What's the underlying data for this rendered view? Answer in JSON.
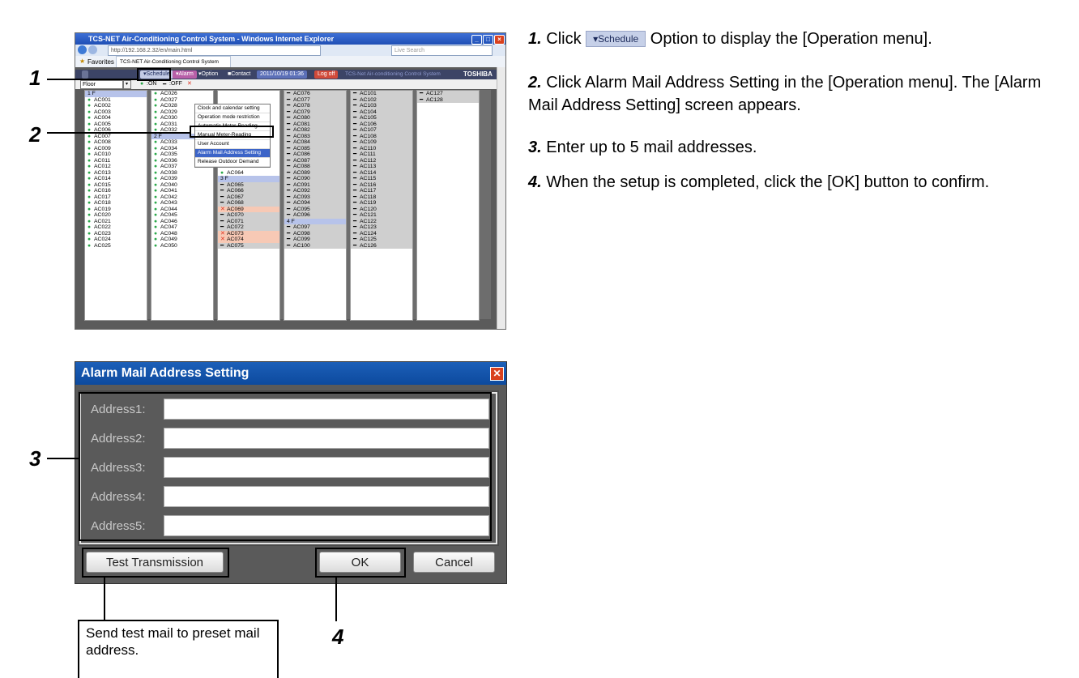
{
  "browser": {
    "title": "TCS-NET Air-Conditioning Control System - Windows Internet Explorer",
    "url": "http://192.168.2.32/en/main.html",
    "search_placeholder": "Live Search",
    "favorites_label": "Favorites",
    "tab_label": "TCS-NET Air-Conditioning Control System"
  },
  "app_nav": {
    "schedule": "▾Schedule",
    "alarm": "▾Alarm",
    "option": "▾Option",
    "contact": "■Contact",
    "datetime": "2011/10/19 01:36",
    "logoff": "Log off",
    "system_name": "TCS-Net Air-conditioning Control System",
    "brand": "TOSHIBA"
  },
  "floor_bar": {
    "select_value": "Floor",
    "on_legend": ":ON",
    "off_legend": ":OFF"
  },
  "operation_menu": [
    "Clock and calendar setting",
    "Operation mode restriction",
    "Automatic Meter-Reading",
    "Manual Meter-Reading",
    "User Account",
    "Alarm Mail Address Setting",
    "Release Outdoor Demand"
  ],
  "unit_columns": [
    [
      {
        "t": "1 F",
        "s": "floor"
      },
      {
        "t": "AC001",
        "s": "on"
      },
      {
        "t": "AC002",
        "s": "on"
      },
      {
        "t": "AC003",
        "s": "on"
      },
      {
        "t": "AC004",
        "s": "on"
      },
      {
        "t": "AC005",
        "s": "on"
      },
      {
        "t": "AC006",
        "s": "on"
      },
      {
        "t": "AC007",
        "s": "on"
      },
      {
        "t": "AC008",
        "s": "on"
      },
      {
        "t": "AC009",
        "s": "on"
      },
      {
        "t": "AC010",
        "s": "on"
      },
      {
        "t": "AC011",
        "s": "on"
      },
      {
        "t": "AC012",
        "s": "on"
      },
      {
        "t": "AC013",
        "s": "on"
      },
      {
        "t": "AC014",
        "s": "on"
      },
      {
        "t": "AC015",
        "s": "on"
      },
      {
        "t": "AC016",
        "s": "on"
      },
      {
        "t": "AC017",
        "s": "on"
      },
      {
        "t": "AC018",
        "s": "on"
      },
      {
        "t": "AC019",
        "s": "on"
      },
      {
        "t": "AC020",
        "s": "on"
      },
      {
        "t": "AC021",
        "s": "on"
      },
      {
        "t": "AC022",
        "s": "on"
      },
      {
        "t": "AC023",
        "s": "on"
      },
      {
        "t": "AC024",
        "s": "on"
      },
      {
        "t": "AC025",
        "s": "on"
      }
    ],
    [
      {
        "t": "AC026",
        "s": "on"
      },
      {
        "t": "AC027",
        "s": "on"
      },
      {
        "t": "AC028",
        "s": "on"
      },
      {
        "t": "AC029",
        "s": "on"
      },
      {
        "t": "AC030",
        "s": "on"
      },
      {
        "t": "AC031",
        "s": "on"
      },
      {
        "t": "AC032",
        "s": "on"
      },
      {
        "t": "2 F",
        "s": "floor"
      },
      {
        "t": "AC033",
        "s": "on"
      },
      {
        "t": "AC034",
        "s": "on"
      },
      {
        "t": "AC035",
        "s": "on"
      },
      {
        "t": "AC036",
        "s": "on"
      },
      {
        "t": "AC037",
        "s": "on"
      },
      {
        "t": "AC038",
        "s": "on"
      },
      {
        "t": "AC039",
        "s": "on"
      },
      {
        "t": "AC040",
        "s": "on"
      },
      {
        "t": "AC041",
        "s": "on"
      },
      {
        "t": "AC042",
        "s": "on"
      },
      {
        "t": "AC043",
        "s": "on"
      },
      {
        "t": "AC044",
        "s": "on"
      },
      {
        "t": "AC045",
        "s": "on"
      },
      {
        "t": "AC046",
        "s": "on"
      },
      {
        "t": "AC047",
        "s": "on"
      },
      {
        "t": "AC048",
        "s": "on"
      },
      {
        "t": "AC049",
        "s": "on"
      },
      {
        "t": "AC050",
        "s": "on"
      }
    ],
    [
      {
        "t": "",
        "s": "blank"
      },
      {
        "t": "",
        "s": "blank"
      },
      {
        "t": "",
        "s": "blank"
      },
      {
        "t": "",
        "s": "blank"
      },
      {
        "t": "",
        "s": "blank"
      },
      {
        "t": "",
        "s": "blank"
      },
      {
        "t": "AC057",
        "s": "on"
      },
      {
        "t": "AC058",
        "s": "on"
      },
      {
        "t": "AC059",
        "s": "on"
      },
      {
        "t": "AC060",
        "s": "on"
      },
      {
        "t": "AC061",
        "s": "on"
      },
      {
        "t": "AC062",
        "s": "on"
      },
      {
        "t": "AC063",
        "s": "on"
      },
      {
        "t": "AC064",
        "s": "on"
      },
      {
        "t": "3 F",
        "s": "floor"
      },
      {
        "t": "AC065",
        "s": "off"
      },
      {
        "t": "AC066",
        "s": "off"
      },
      {
        "t": "AC067",
        "s": "off"
      },
      {
        "t": "AC068",
        "s": "off"
      },
      {
        "t": "AC069",
        "s": "err"
      },
      {
        "t": "AC070",
        "s": "off"
      },
      {
        "t": "AC071",
        "s": "off"
      },
      {
        "t": "AC072",
        "s": "off"
      },
      {
        "t": "AC073",
        "s": "err"
      },
      {
        "t": "AC074",
        "s": "err"
      },
      {
        "t": "AC075",
        "s": "off"
      }
    ],
    [
      {
        "t": "AC076",
        "s": "off"
      },
      {
        "t": "AC077",
        "s": "off"
      },
      {
        "t": "AC078",
        "s": "off"
      },
      {
        "t": "AC079",
        "s": "off"
      },
      {
        "t": "AC080",
        "s": "off"
      },
      {
        "t": "AC081",
        "s": "off"
      },
      {
        "t": "AC082",
        "s": "off"
      },
      {
        "t": "AC083",
        "s": "off"
      },
      {
        "t": "AC084",
        "s": "off"
      },
      {
        "t": "AC085",
        "s": "off"
      },
      {
        "t": "AC086",
        "s": "off"
      },
      {
        "t": "AC087",
        "s": "off"
      },
      {
        "t": "AC088",
        "s": "off"
      },
      {
        "t": "AC089",
        "s": "off"
      },
      {
        "t": "AC090",
        "s": "off"
      },
      {
        "t": "AC091",
        "s": "off"
      },
      {
        "t": "AC092",
        "s": "off"
      },
      {
        "t": "AC093",
        "s": "off"
      },
      {
        "t": "AC094",
        "s": "off"
      },
      {
        "t": "AC095",
        "s": "off"
      },
      {
        "t": "AC096",
        "s": "off"
      },
      {
        "t": "4 F",
        "s": "floor"
      },
      {
        "t": "AC097",
        "s": "off"
      },
      {
        "t": "AC098",
        "s": "off"
      },
      {
        "t": "AC099",
        "s": "off"
      },
      {
        "t": "AC100",
        "s": "off"
      }
    ],
    [
      {
        "t": "AC101",
        "s": "off"
      },
      {
        "t": "AC102",
        "s": "off"
      },
      {
        "t": "AC103",
        "s": "off"
      },
      {
        "t": "AC104",
        "s": "off"
      },
      {
        "t": "AC105",
        "s": "off"
      },
      {
        "t": "AC106",
        "s": "off"
      },
      {
        "t": "AC107",
        "s": "off"
      },
      {
        "t": "AC108",
        "s": "off"
      },
      {
        "t": "AC109",
        "s": "off"
      },
      {
        "t": "AC110",
        "s": "off"
      },
      {
        "t": "AC111",
        "s": "off"
      },
      {
        "t": "AC112",
        "s": "off"
      },
      {
        "t": "AC113",
        "s": "off"
      },
      {
        "t": "AC114",
        "s": "off"
      },
      {
        "t": "AC115",
        "s": "off"
      },
      {
        "t": "AC116",
        "s": "off"
      },
      {
        "t": "AC117",
        "s": "off"
      },
      {
        "t": "AC118",
        "s": "off"
      },
      {
        "t": "AC119",
        "s": "off"
      },
      {
        "t": "AC120",
        "s": "off"
      },
      {
        "t": "AC121",
        "s": "off"
      },
      {
        "t": "AC122",
        "s": "off"
      },
      {
        "t": "AC123",
        "s": "off"
      },
      {
        "t": "AC124",
        "s": "off"
      },
      {
        "t": "AC125",
        "s": "off"
      },
      {
        "t": "AC126",
        "s": "off"
      }
    ],
    [
      {
        "t": "AC127",
        "s": "off"
      },
      {
        "t": "AC128",
        "s": "off"
      }
    ]
  ],
  "dialog": {
    "title": "Alarm Mail Address Setting",
    "fields": [
      {
        "label": "Address1:",
        "value": ""
      },
      {
        "label": "Address2:",
        "value": ""
      },
      {
        "label": "Address3:",
        "value": ""
      },
      {
        "label": "Address4:",
        "value": ""
      },
      {
        "label": "Address5:",
        "value": ""
      }
    ],
    "test_button": "Test Transmission",
    "ok_button": "OK",
    "cancel_button": "Cancel"
  },
  "callouts": {
    "c1": "1",
    "c2": "2",
    "c3": "3",
    "c4": "4"
  },
  "note_text": "Send test mail to preset mail address.",
  "steps": {
    "s1_num": "1.",
    "s1_pre": "Click",
    "s1_chip": "▾Schedule",
    "s1_post": "Option to display the [Operation menu].",
    "s2_num": "2.",
    "s2_text": "Click Alarm Mail Address Setting in the [Operation menu]. The [Alarm Mail Address Setting] screen appears.",
    "s3_num": "3.",
    "s3_text": "Enter up to 5 mail addresses.",
    "s4_num": "4.",
    "s4_text": "When the setup is completed, click the [OK] button to confirm."
  },
  "colors": {
    "on_marker": "#2aa84a",
    "err_marker": "#e0311e",
    "nav_bg": "#3c4466",
    "dialog_title": "#1c5fb8"
  }
}
